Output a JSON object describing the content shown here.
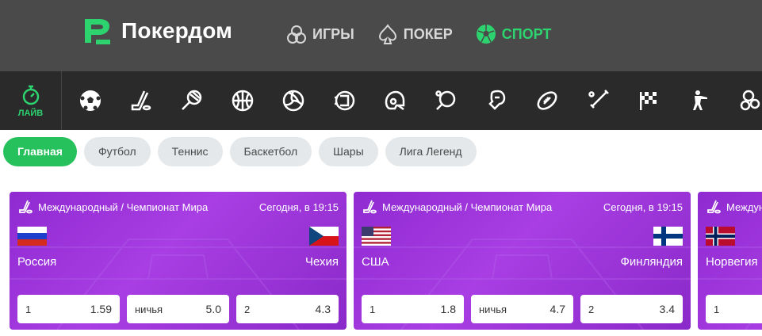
{
  "brand": {
    "name": "Покердом"
  },
  "nav": [
    {
      "label": "ИГРЫ",
      "icon": "slot-icon",
      "active": false
    },
    {
      "label": "ПОКЕР",
      "icon": "spade-icon",
      "active": false
    },
    {
      "label": "СПОРТ",
      "icon": "football-icon",
      "active": true
    }
  ],
  "sportbar": {
    "live_label": "ЛАЙВ",
    "icons": [
      "soccer-ball-icon",
      "hockey-icon",
      "tennis-icon",
      "basketball-icon",
      "volleyball-icon",
      "esports-ball-icon",
      "helmet-icon",
      "table-tennis-icon",
      "boxing-icon",
      "american-football-icon",
      "baseball-icon",
      "racing-flag-icon",
      "shooter-icon",
      "more-icon"
    ]
  },
  "chips": [
    {
      "label": "Главная",
      "active": true
    },
    {
      "label": "Футбол",
      "active": false
    },
    {
      "label": "Теннис",
      "active": false
    },
    {
      "label": "Баскетбол",
      "active": false
    },
    {
      "label": "Шары",
      "active": false
    },
    {
      "label": "Лига Легенд",
      "active": false
    }
  ],
  "matches": [
    {
      "tournament": "Международный / Чемпионат Мира",
      "time": "Сегодня, в 19:15",
      "home": "Россия",
      "away": "Чехия",
      "odds": [
        {
          "label": "1",
          "value": "1.59"
        },
        {
          "label": "ничья",
          "value": "5.0"
        },
        {
          "label": "2",
          "value": "4.3"
        }
      ]
    },
    {
      "tournament": "Международный / Чемпионат Мира",
      "time": "Сегодня, в 19:15",
      "home": "США",
      "away": "Финляндия",
      "odds": [
        {
          "label": "1",
          "value": "1.8"
        },
        {
          "label": "ничья",
          "value": "4.7"
        },
        {
          "label": "2",
          "value": "3.4"
        }
      ]
    },
    {
      "tournament": "Междунаро",
      "time": "",
      "home": "Норвегия",
      "away": "",
      "odds": [
        {
          "label": "1",
          "value": ""
        },
        {
          "label": "",
          "value": ""
        },
        {
          "label": "",
          "value": ""
        }
      ]
    }
  ],
  "colors": {
    "header_bg": "#4a4a4a",
    "sportbar_bg": "#2a2a2a",
    "accent_green": "#2dd36f",
    "card_purple": "#9b35da"
  }
}
